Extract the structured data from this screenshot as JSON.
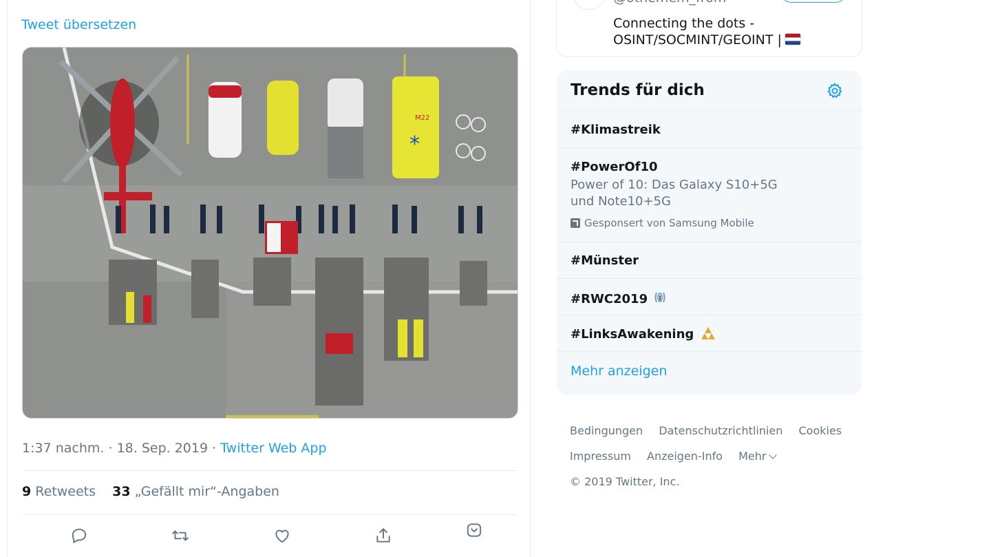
{
  "tweet": {
    "translate_label": "Tweet übersetzen",
    "time": "1:37 nachm.",
    "date": "18. Sep. 2019",
    "separator": "·",
    "source": "Twitter Web App",
    "retweet_count": "9",
    "retweet_label": "Retweets",
    "like_count": "33",
    "like_label": "„Gefällt mir“-Angaben",
    "actions": [
      {
        "icon": "reply-icon"
      },
      {
        "icon": "retweet-icon"
      },
      {
        "icon": "like-icon"
      },
      {
        "icon": "share-icon"
      },
      {
        "icon": "chevron-down-icon"
      }
    ]
  },
  "who_to_follow": {
    "handle": "@othemem_from",
    "bio": "Connecting the dots - OSINT/SOCMINT/GEOINT |"
  },
  "trends": {
    "title": "Trends für dich",
    "items": [
      {
        "tag": "#Klimastreik"
      },
      {
        "tag": "#PowerOf10",
        "description": "Power of 10: Das Galaxy S10+5G und Note10+5G",
        "promoted": "Gesponsert von Samsung Mobile"
      },
      {
        "tag": "#Münster"
      },
      {
        "tag": "#RWC2019"
      },
      {
        "tag": "#LinksAwakening"
      }
    ],
    "more_label": "Mehr anzeigen"
  },
  "footer": {
    "links": [
      "Bedingungen",
      "Datenschutzrichtlinien",
      "Cookies",
      "Impressum",
      "Anzeigen-Info",
      "Mehr"
    ],
    "copyright": "© 2019 Twitter, Inc."
  },
  "colors": {
    "accent": "#1da1f2",
    "muted": "#657786",
    "border": "#e6ecf0",
    "panel": "#f5f8fa"
  }
}
